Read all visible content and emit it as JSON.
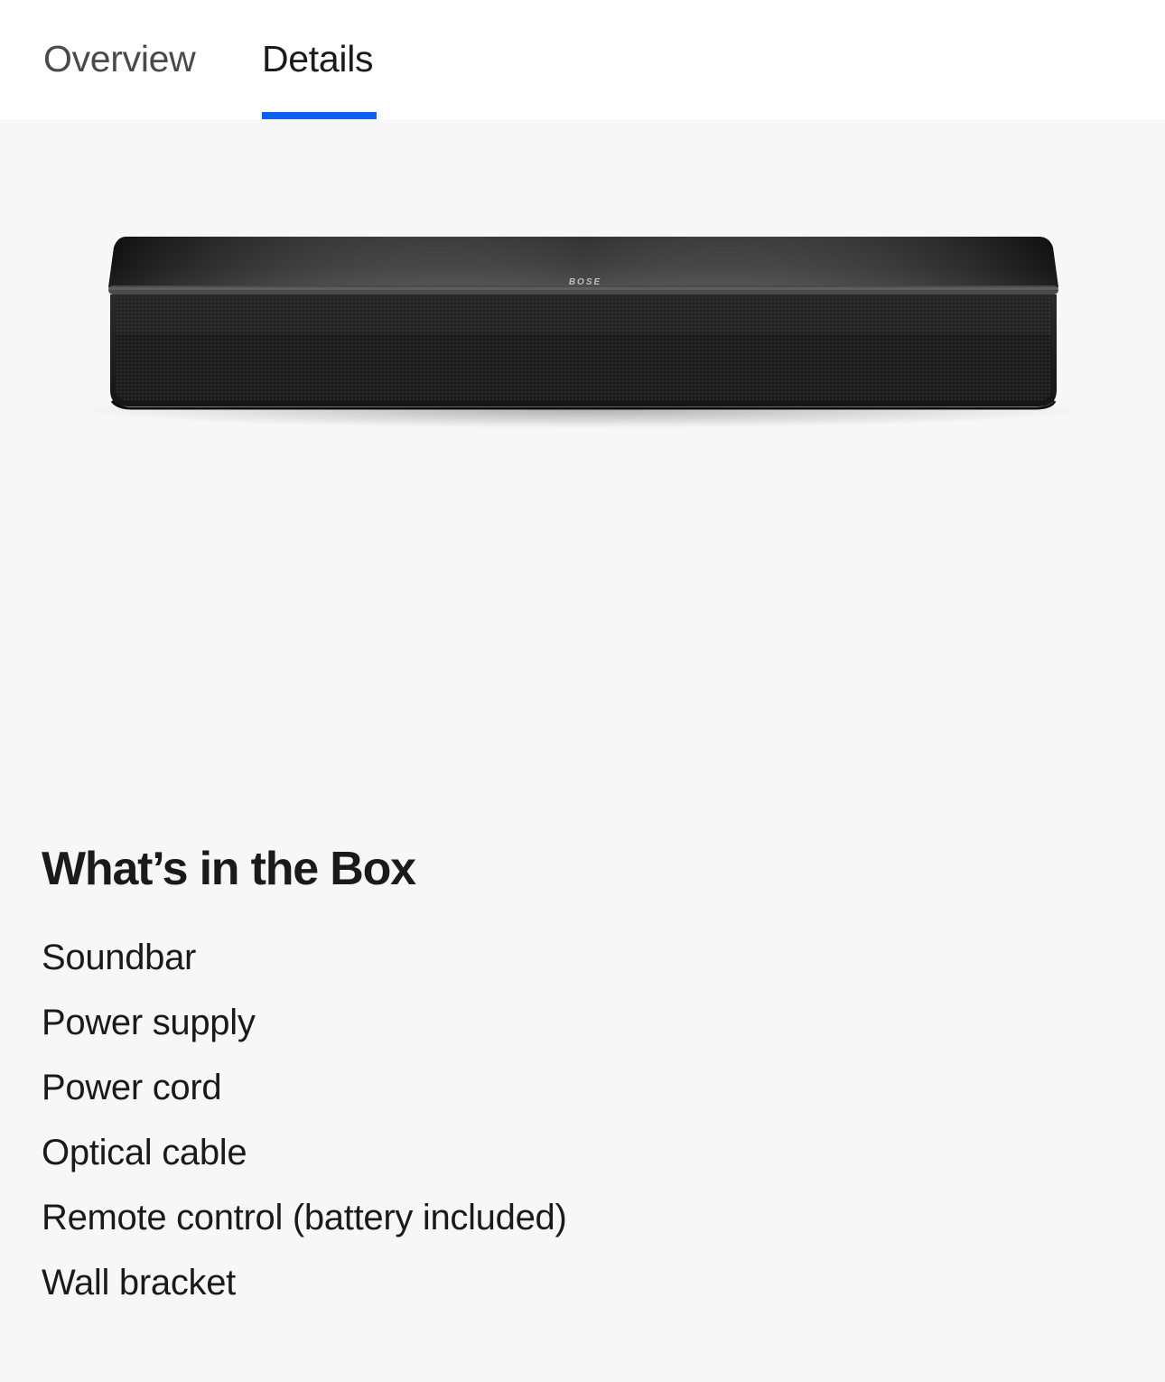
{
  "tabs": {
    "overview": "Overview",
    "details": "Details"
  },
  "accent_color": "#1060f0",
  "product_image": {
    "icon": "soundbar-product-image",
    "logo_text": "BOSE"
  },
  "section": {
    "title": "What’s in the Box",
    "items": [
      "Soundbar",
      "Power supply",
      "Power cord",
      "Optical cable",
      "Remote control (battery included)",
      "Wall bracket"
    ]
  }
}
